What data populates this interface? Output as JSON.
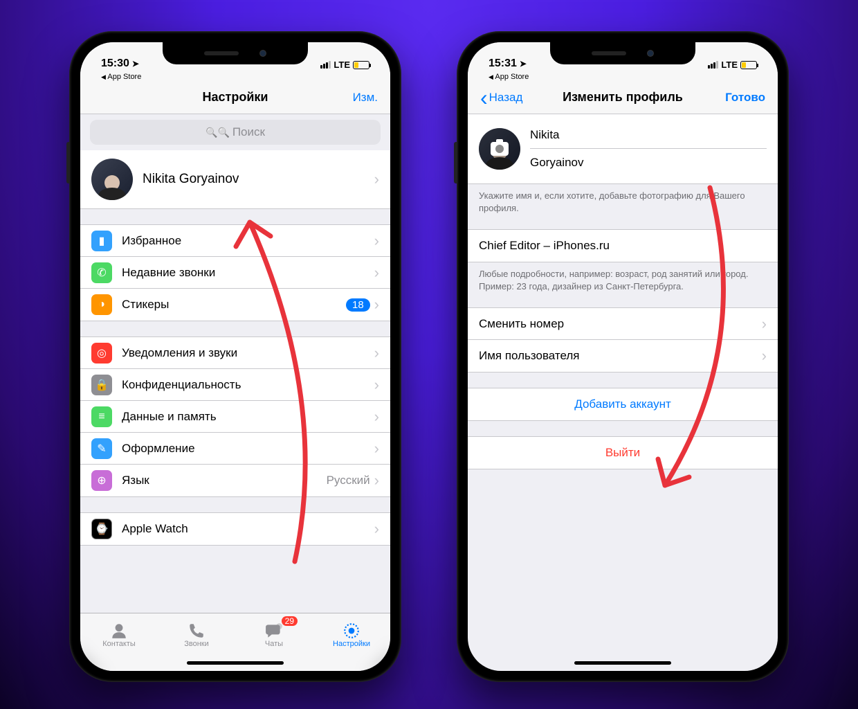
{
  "colors": {
    "accent": "#007AFF",
    "danger": "#FF3B30"
  },
  "statusbar": {
    "breadcrumb": "App Store",
    "network": "LTE"
  },
  "left": {
    "time": "15:30",
    "nav": {
      "title": "Настройки",
      "edit": "Изм."
    },
    "search": {
      "placeholder": "Поиск"
    },
    "profile": {
      "name": "Nikita Goryainov"
    },
    "group1": [
      {
        "icon": "bookmark",
        "bg": "#33A1FD",
        "label": "Избранное"
      },
      {
        "icon": "phone",
        "bg": "#4CD964",
        "label": "Недавние звонки"
      },
      {
        "icon": "moon",
        "bg": "#FF9500",
        "label": "Стикеры",
        "badge": "18"
      }
    ],
    "group2": [
      {
        "icon": "bell",
        "bg": "#FF3B30",
        "label": "Уведомления и звуки"
      },
      {
        "icon": "lock",
        "bg": "#8E8E93",
        "label": "Конфиденциальность"
      },
      {
        "icon": "disk",
        "bg": "#4CD964",
        "label": "Данные и память"
      },
      {
        "icon": "brush",
        "bg": "#33A1FD",
        "label": "Оформление"
      },
      {
        "icon": "globe",
        "bg": "#C86DD7",
        "label": "Язык",
        "detail": "Русский"
      }
    ],
    "group3": [
      {
        "icon": "watch",
        "bg": "#8E8E93",
        "label": "Apple Watch"
      }
    ],
    "tabs": {
      "contacts": "Контакты",
      "calls": "Звонки",
      "chats": "Чаты",
      "chats_badge": "29",
      "settings": "Настройки"
    }
  },
  "right": {
    "time": "15:31",
    "nav": {
      "back": "Назад",
      "title": "Изменить профиль",
      "done": "Готово"
    },
    "name_fields": {
      "first": "Nikita",
      "last": "Goryainov"
    },
    "hint_name": "Укажите имя и, если хотите, добавьте фотографию для Вашего профиля.",
    "bio": "Chief Editor – iPhones.ru",
    "hint_bio": "Любые подробности, например: возраст, род занятий или город.\nПример: 23 года, дизайнер из Санкт-Петербурга.",
    "actions": {
      "change_number": "Сменить номер",
      "username": "Имя пользователя",
      "add_account": "Добавить аккаунт",
      "logout": "Выйти"
    }
  }
}
